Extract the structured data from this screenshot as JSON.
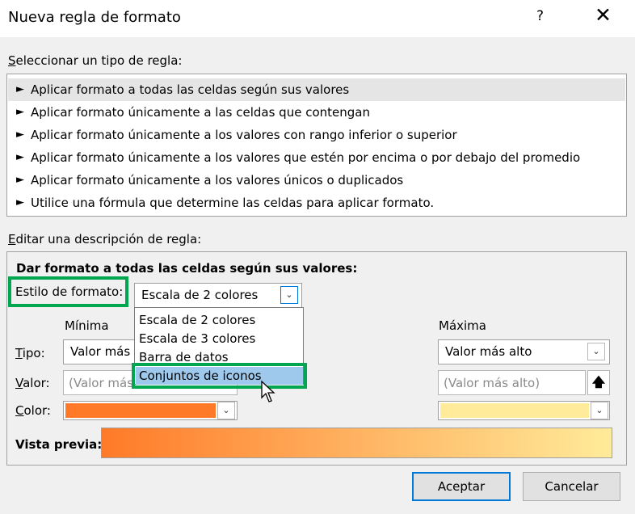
{
  "dialog": {
    "title": "Nueva regla de formato",
    "help_symbol": "?",
    "close_symbol": "✕"
  },
  "rule_type": {
    "label": "Seleccionar un tipo de regla:",
    "items": [
      {
        "text": "Aplicar formato a todas las celdas según sus valores",
        "selected": true
      },
      {
        "text": "Aplicar formato únicamente a las celdas que contengan"
      },
      {
        "text": "Aplicar formato únicamente a los valores con rango inferior o superior"
      },
      {
        "text": "Aplicar formato únicamente a los valores que estén por encima o por debajo del promedio"
      },
      {
        "text": "Aplicar formato únicamente a los valores únicos o duplicados"
      },
      {
        "text": "Utilice una fórmula que determine las celdas para aplicar formato."
      }
    ],
    "arrow_glyph": "►"
  },
  "description": {
    "label": "Editar una descripción de regla:",
    "heading": "Dar formato a todas las celdas según sus valores:",
    "style_label": "Estilo de formato:",
    "style_value": "Escala de 2 colores",
    "style_options": [
      "Escala de 2 colores",
      "Escala de 3 colores",
      "Barra de datos",
      "Conjuntos de iconos"
    ],
    "highlighted_option": "Conjuntos de iconos",
    "min_header": "Mínima",
    "max_header": "Máxima",
    "type_label": "Tipo:",
    "value_label": "Valor:",
    "color_label": "Color:",
    "min_type": "Valor más",
    "min_value_placeholder": "(Valor más",
    "max_type": "Valor más alto",
    "max_value_placeholder": "(Valor más alto)",
    "min_color": "#ff7a28",
    "max_color": "#ffeb9a",
    "preview_label": "Vista previa:"
  },
  "buttons": {
    "accept": "Aceptar",
    "cancel": "Cancelar"
  },
  "colors": {
    "highlight_box": "#00a650",
    "dropdown_highlight": "#9ec9ec",
    "default_button_border": "#0078d7"
  }
}
